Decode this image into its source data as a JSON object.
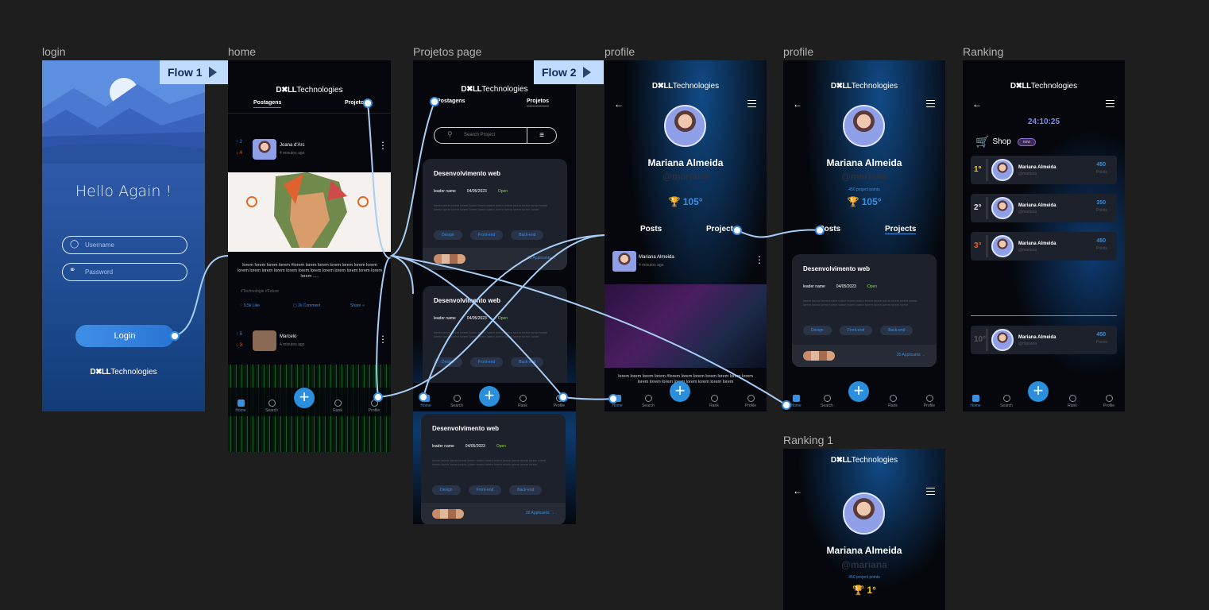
{
  "labels": {
    "login": "login",
    "home": "home",
    "projetos": "Projetos page",
    "profile1": "profile",
    "profile2": "profile",
    "ranking": "Ranking",
    "ranking1": "Ranking 1"
  },
  "flows": {
    "flow1": "Flow 1",
    "flow2": "Flow 2"
  },
  "brand": {
    "dell": "D✖LL",
    "tech": "Technologies"
  },
  "login": {
    "title": "Hello Again !",
    "username_placeholder": "Username",
    "password_placeholder": "Password",
    "button": "Login"
  },
  "home": {
    "tab1": "Postagens",
    "tab2": "Projetos",
    "post1": {
      "up": "2",
      "down": "4",
      "name": "Joana d'Arc",
      "time": "4 minutos ago",
      "text": "lorem lorem lorem lorem #lorem lorem lorem lorem lorem lorem lorem lorem lorem lorem lorem lorem lorem lorem lorem lorem lorem lorem lorem lorem .....",
      "tags": "#Technologie #Future",
      "likes": "9.5k Like",
      "comments": "2k Comment",
      "share": "Share"
    },
    "post2": {
      "up": "5",
      "down": "3",
      "name": "Marcelo",
      "time": "4 minutos ago"
    }
  },
  "nav": {
    "home": "Home",
    "search": "Search",
    "rank": "Rank",
    "profile": "Profile"
  },
  "projetos": {
    "tab1": "Postagens",
    "tab2": "Projetos",
    "search_placeholder": "Search Project",
    "card": {
      "title": "Desenvolvimento web",
      "leader": "leader name",
      "date": "04/05/2023",
      "status": "Open",
      "lorem": "lorem lorem lorem lorem lorem lorem lorem lorem lorem lorem lorem lorem lorem lorem lorem lorem lorem lorem lorem lorem lorem lorem lorem lorem lorem",
      "chips": [
        "Design",
        "Front-end",
        "Back-end"
      ],
      "applicants": "20 Applicants →"
    }
  },
  "profile": {
    "name": "Mariana Almeida",
    "handle": "@mariana",
    "score": "105°",
    "posts": "Posts",
    "projects": "Projects",
    "project_points": "450 project points",
    "post_author": "Mariana Almeida",
    "post_time": "4 minutos ago",
    "post_text": "lorem lorem lorem lorem #lorem lorem lorem lorem lorem lorem lorem lorem lorem lorem lorem lorem lorem lorem lorem"
  },
  "ranking": {
    "timer": "24:10:25",
    "shop": "Shop",
    "new_badge": "new",
    "rows": [
      {
        "pos": "1°",
        "name": "Mariana Almeida",
        "handle": "@mariana",
        "points": "450",
        "label": "Points",
        "color": "#f5c518"
      },
      {
        "pos": "2°",
        "name": "Mariana Almeida",
        "handle": "@mariana",
        "points": "350",
        "label": "Points",
        "color": "#dfe2e8"
      },
      {
        "pos": "3°",
        "name": "Mariana Almeida",
        "handle": "@mariana",
        "points": "450",
        "label": "Points",
        "color": "#e0622f"
      }
    ],
    "self": {
      "pos": "10°",
      "name": "Mariana Almeida",
      "handle": "@mariana",
      "points": "450",
      "label": "Points"
    }
  },
  "ranking1": {
    "rank": "1°"
  }
}
